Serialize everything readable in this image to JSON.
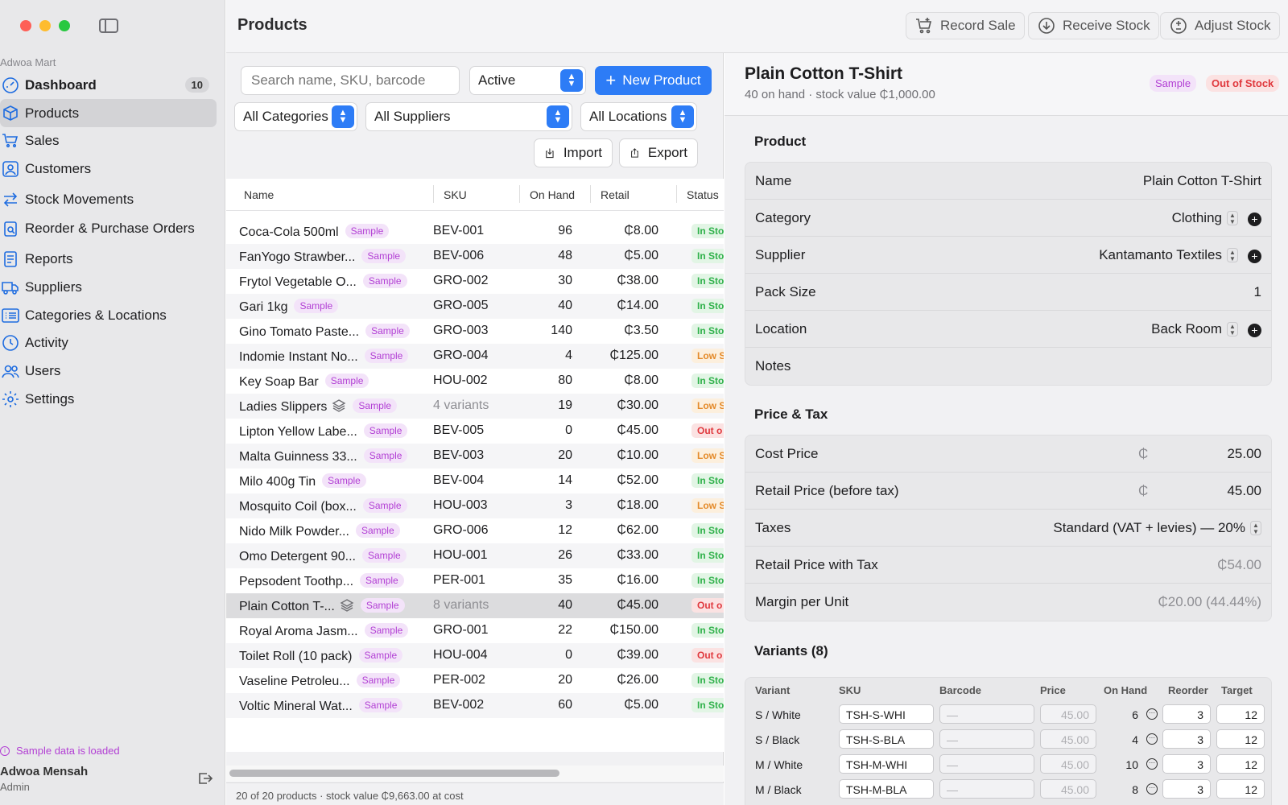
{
  "sidebar": {
    "store_name": "Adwoa Mart",
    "items": [
      {
        "label": "Dashboard",
        "icon": "dashboard-icon",
        "badge": "10"
      },
      {
        "label": "Products",
        "icon": "cube-icon"
      },
      {
        "label": "Sales",
        "icon": "cart-icon"
      },
      {
        "label": "Customers",
        "icon": "person-icon"
      },
      {
        "label": "Stock Movements",
        "icon": "arrows-icon"
      },
      {
        "label": "Reorder & Purchase Orders",
        "icon": "clipboard-icon"
      },
      {
        "label": "Reports",
        "icon": "report-icon"
      },
      {
        "label": "Suppliers",
        "icon": "truck-icon"
      },
      {
        "label": "Categories & Locations",
        "icon": "list-icon"
      },
      {
        "label": "Activity",
        "icon": "clock-icon"
      },
      {
        "label": "Users",
        "icon": "users-icon"
      },
      {
        "label": "Settings",
        "icon": "gear-icon"
      }
    ],
    "sample_note": "Sample data is loaded",
    "user_name": "Adwoa Mensah",
    "user_role": "Admin"
  },
  "header": {
    "title": "Products",
    "record_sale": "Record Sale",
    "receive_stock": "Receive Stock",
    "adjust_stock": "Adjust Stock"
  },
  "filters": {
    "search_placeholder": "Search name, SKU, barcode",
    "status": "Active",
    "new_product": "New Product",
    "category": "All Categories",
    "supplier": "All Suppliers",
    "location": "All Locations",
    "import": "Import",
    "export": "Export"
  },
  "table": {
    "columns": [
      "Name",
      "SKU",
      "On Hand",
      "Retail",
      "Status"
    ],
    "sample_tag": "Sample",
    "rows": [
      {
        "name": "Coca-Cola 500ml",
        "sku": "BEV-001",
        "on_hand": "96",
        "retail": "₵8.00",
        "status": "In Sto",
        "kind": "in"
      },
      {
        "name": "FanYogo Strawber...",
        "sku": "BEV-006",
        "on_hand": "48",
        "retail": "₵5.00",
        "status": "In Sto",
        "kind": "in"
      },
      {
        "name": "Frytol Vegetable O...",
        "sku": "GRO-002",
        "on_hand": "30",
        "retail": "₵38.00",
        "status": "In Sto",
        "kind": "in"
      },
      {
        "name": "Gari 1kg",
        "sku": "GRO-005",
        "on_hand": "40",
        "retail": "₵14.00",
        "status": "In Sto",
        "kind": "in"
      },
      {
        "name": "Gino Tomato Paste...",
        "sku": "GRO-003",
        "on_hand": "140",
        "retail": "₵3.50",
        "status": "In Sto",
        "kind": "in"
      },
      {
        "name": "Indomie Instant No...",
        "sku": "GRO-004",
        "on_hand": "4",
        "retail": "₵125.00",
        "status": "Low S",
        "kind": "low"
      },
      {
        "name": "Key Soap Bar",
        "sku": "HOU-002",
        "on_hand": "80",
        "retail": "₵8.00",
        "status": "In Sto",
        "kind": "in"
      },
      {
        "name": "Ladies Slippers",
        "sku": "4 variants",
        "on_hand": "19",
        "retail": "₵30.00",
        "status": "Low S",
        "kind": "low",
        "variants": true
      },
      {
        "name": "Lipton Yellow Labe...",
        "sku": "BEV-005",
        "on_hand": "0",
        "retail": "₵45.00",
        "status": "Out o",
        "kind": "out"
      },
      {
        "name": "Malta Guinness 33...",
        "sku": "BEV-003",
        "on_hand": "20",
        "retail": "₵10.00",
        "status": "Low S",
        "kind": "low"
      },
      {
        "name": "Milo 400g Tin",
        "sku": "BEV-004",
        "on_hand": "14",
        "retail": "₵52.00",
        "status": "In Sto",
        "kind": "in"
      },
      {
        "name": "Mosquito Coil (box...",
        "sku": "HOU-003",
        "on_hand": "3",
        "retail": "₵18.00",
        "status": "Low S",
        "kind": "low"
      },
      {
        "name": "Nido Milk Powder...",
        "sku": "GRO-006",
        "on_hand": "12",
        "retail": "₵62.00",
        "status": "In Sto",
        "kind": "in"
      },
      {
        "name": "Omo Detergent 90...",
        "sku": "HOU-001",
        "on_hand": "26",
        "retail": "₵33.00",
        "status": "In Sto",
        "kind": "in"
      },
      {
        "name": "Pepsodent Toothp...",
        "sku": "PER-001",
        "on_hand": "35",
        "retail": "₵16.00",
        "status": "In Sto",
        "kind": "in"
      },
      {
        "name": "Plain Cotton T-...",
        "sku": "8 variants",
        "on_hand": "40",
        "retail": "₵45.00",
        "status": "Out o",
        "kind": "out",
        "variants": true,
        "selected": true
      },
      {
        "name": "Royal Aroma Jasm...",
        "sku": "GRO-001",
        "on_hand": "22",
        "retail": "₵150.00",
        "status": "In Sto",
        "kind": "in"
      },
      {
        "name": "Toilet Roll (10 pack)",
        "sku": "HOU-004",
        "on_hand": "0",
        "retail": "₵39.00",
        "status": "Out o",
        "kind": "out"
      },
      {
        "name": "Vaseline Petroleu...",
        "sku": "PER-002",
        "on_hand": "20",
        "retail": "₵26.00",
        "status": "In Sto",
        "kind": "in"
      },
      {
        "name": "Voltic Mineral Wat...",
        "sku": "BEV-002",
        "on_hand": "60",
        "retail": "₵5.00",
        "status": "In Sto",
        "kind": "in"
      }
    ],
    "footer": "20 of 20 products · stock value ₵9,663.00 at cost"
  },
  "detail": {
    "title": "Plain Cotton T-Shirt",
    "subtitle": "40 on hand · stock value ₵1,000.00",
    "badge_sample": "Sample",
    "badge_status": "Out of Stock",
    "product_section": "Product",
    "name_label": "Name",
    "name_value": "Plain Cotton T-Shirt",
    "category_label": "Category",
    "category_value": "Clothing",
    "supplier_label": "Supplier",
    "supplier_value": "Kantamanto Textiles",
    "pack_label": "Pack Size",
    "pack_value": "1",
    "location_label": "Location",
    "location_value": "Back Room",
    "notes_label": "Notes",
    "price_section": "Price & Tax",
    "currency": "₵",
    "cost_label": "Cost Price",
    "cost_value": "25.00",
    "retail_label": "Retail Price (before tax)",
    "retail_value": "45.00",
    "taxes_label": "Taxes",
    "taxes_value": "Standard (VAT + levies) — 20%",
    "retail_tax_label": "Retail Price with Tax",
    "retail_tax_value": "₵54.00",
    "margin_label": "Margin per Unit",
    "margin_value": "₵20.00 (44.44%)",
    "variants_section": "Variants (8)",
    "variant_columns": [
      "Variant",
      "SKU",
      "Barcode",
      "Price",
      "On Hand",
      "Reorder",
      "Target"
    ],
    "barcode_placeholder": "—",
    "variants": [
      {
        "name": "S / White",
        "sku": "TSH-S-WHI",
        "price": "45.00",
        "on_hand": "6",
        "reorder": "3",
        "target": "12"
      },
      {
        "name": "S / Black",
        "sku": "TSH-S-BLA",
        "price": "45.00",
        "on_hand": "4",
        "reorder": "3",
        "target": "12"
      },
      {
        "name": "M / White",
        "sku": "TSH-M-WHI",
        "price": "45.00",
        "on_hand": "10",
        "reorder": "3",
        "target": "12"
      },
      {
        "name": "M / Black",
        "sku": "TSH-M-BLA",
        "price": "45.00",
        "on_hand": "8",
        "reorder": "3",
        "target": "12"
      }
    ]
  },
  "colors": {
    "accent": "#2d7cf6",
    "sample": "#b23fd4",
    "in_stock": "#2fb14a",
    "low_stock": "#e48a2a",
    "out_of_stock": "#e0393e"
  }
}
